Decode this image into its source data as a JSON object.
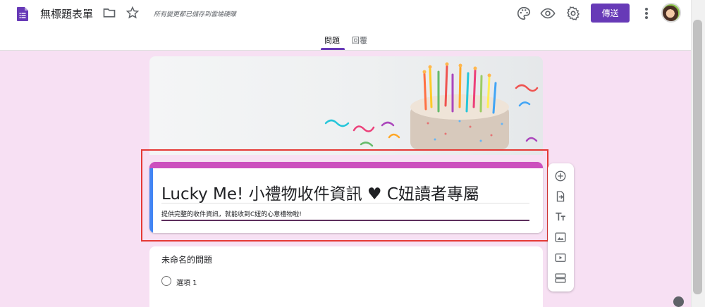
{
  "header": {
    "title": "無標題表單",
    "save_status": "所有變更都已儲存到雲端硬碟",
    "send_label": "傳送",
    "icons": [
      "form-icon",
      "folder-icon",
      "star-icon",
      "palette-icon",
      "preview-icon",
      "settings-icon",
      "more-icon",
      "avatar"
    ]
  },
  "tabs": [
    {
      "label": "問題",
      "active": true
    },
    {
      "label": "回覆",
      "active": false
    }
  ],
  "form": {
    "title": "Lucky Me!  小禮物收件資訊 ♥ C妞讀者專屬",
    "description": "提供完整的收件資訊，就能收到C妞的心意禮物啦!",
    "accent_color": "#cc4fbe"
  },
  "question": {
    "title": "未命名的問題",
    "options": [
      "選項 1"
    ]
  },
  "side_toolbar": [
    "add-question-icon",
    "import-questions-icon",
    "add-title-icon",
    "add-image-icon",
    "add-video-icon",
    "add-section-icon"
  ],
  "colors": {
    "brand": "#673ab7",
    "page_bg": "#f7e0f3",
    "highlight": "#e53935"
  }
}
